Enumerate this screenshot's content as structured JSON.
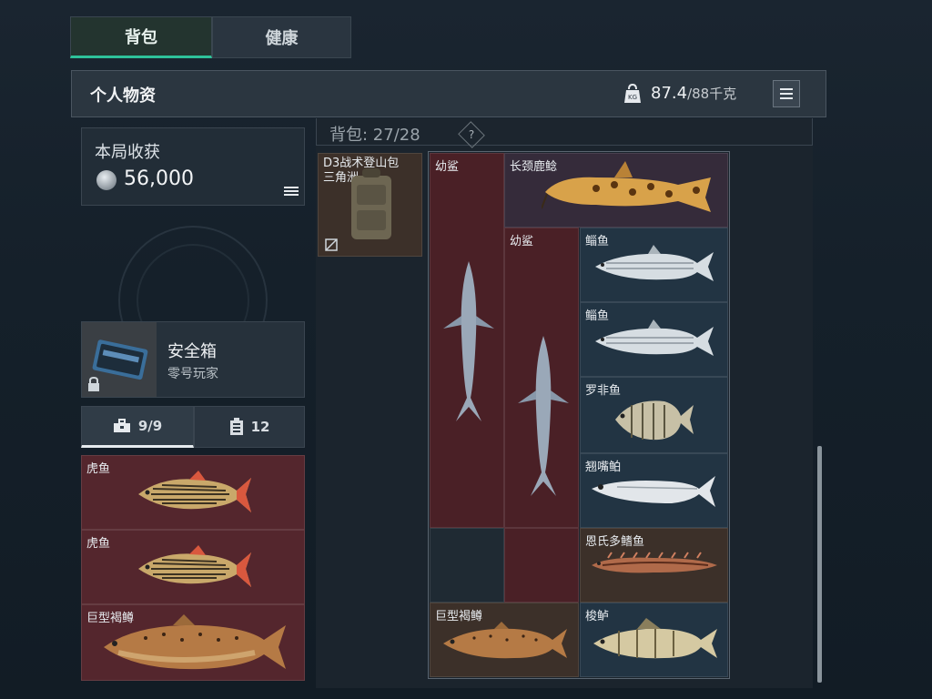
{
  "tabs": [
    {
      "label": "背包",
      "active": true
    },
    {
      "label": "健康",
      "active": false
    }
  ],
  "header": {
    "title": "个人物资",
    "weight_icon": "kg-weight-icon",
    "weight_current": "87.4",
    "weight_max": "/88千克"
  },
  "earnings": {
    "title": "本局收获",
    "value": "56,000"
  },
  "safe_box": {
    "title": "安全箱",
    "owner": "零号玩家"
  },
  "sub_tabs": [
    {
      "icon": "toolbox-icon",
      "label": "9/9",
      "active": true
    },
    {
      "icon": "container-icon",
      "label": "12",
      "active": false
    }
  ],
  "backpack": {
    "label": "背包: 27/28",
    "help": "?",
    "item": "D3战术登山包 三角洲"
  },
  "left_items": [
    {
      "name": "虎鱼"
    },
    {
      "name": "虎鱼"
    },
    {
      "name": "巨型褐鳟"
    }
  ],
  "right_items": [
    {
      "name": "幼鲨"
    },
    {
      "name": "长颈鹿鲶"
    },
    {
      "name": "幼鲨"
    },
    {
      "name": "鲻鱼"
    },
    {
      "name": "鲻鱼"
    },
    {
      "name": "罗非鱼"
    },
    {
      "name": "翘嘴鲌"
    },
    {
      "name": "恩氏多鳍鱼"
    },
    {
      "name": "巨型褐鳟"
    },
    {
      "name": "梭鲈"
    }
  ],
  "colors": {
    "accent_teal": "#2ec29a",
    "rare_red": "#54262d",
    "common_blue": "#223443",
    "epic_purple": "#352b3a",
    "brown": "#3c3029"
  }
}
